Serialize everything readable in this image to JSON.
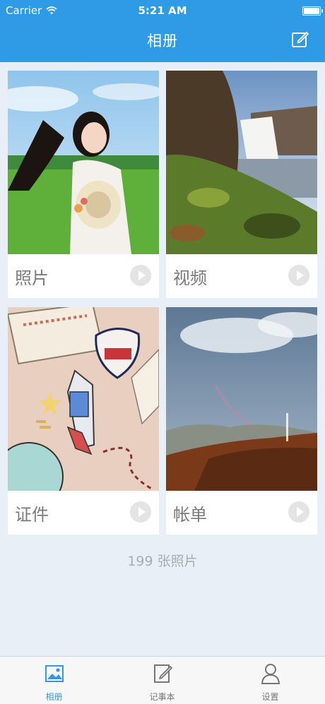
{
  "status_bar": {
    "carrier": "Carrier",
    "time": "5:21 AM"
  },
  "nav": {
    "title": "相册",
    "edit_icon": "compose-icon"
  },
  "albums": [
    {
      "label": "照片",
      "icon": "play-circle-icon"
    },
    {
      "label": "视频",
      "icon": "play-circle-icon"
    },
    {
      "label": "证件",
      "icon": "play-circle-icon"
    },
    {
      "label": "帐单",
      "icon": "play-circle-icon"
    }
  ],
  "photo_count": "199 张照片",
  "tabbar": [
    {
      "label": "相册",
      "icon": "photo-icon",
      "active": true
    },
    {
      "label": "记事本",
      "icon": "notepad-icon",
      "active": false
    },
    {
      "label": "设置",
      "icon": "person-icon",
      "active": false
    }
  ],
  "colors": {
    "accent": "#2f9be6",
    "background": "#e9eff6",
    "tab_inactive": "#777777"
  }
}
